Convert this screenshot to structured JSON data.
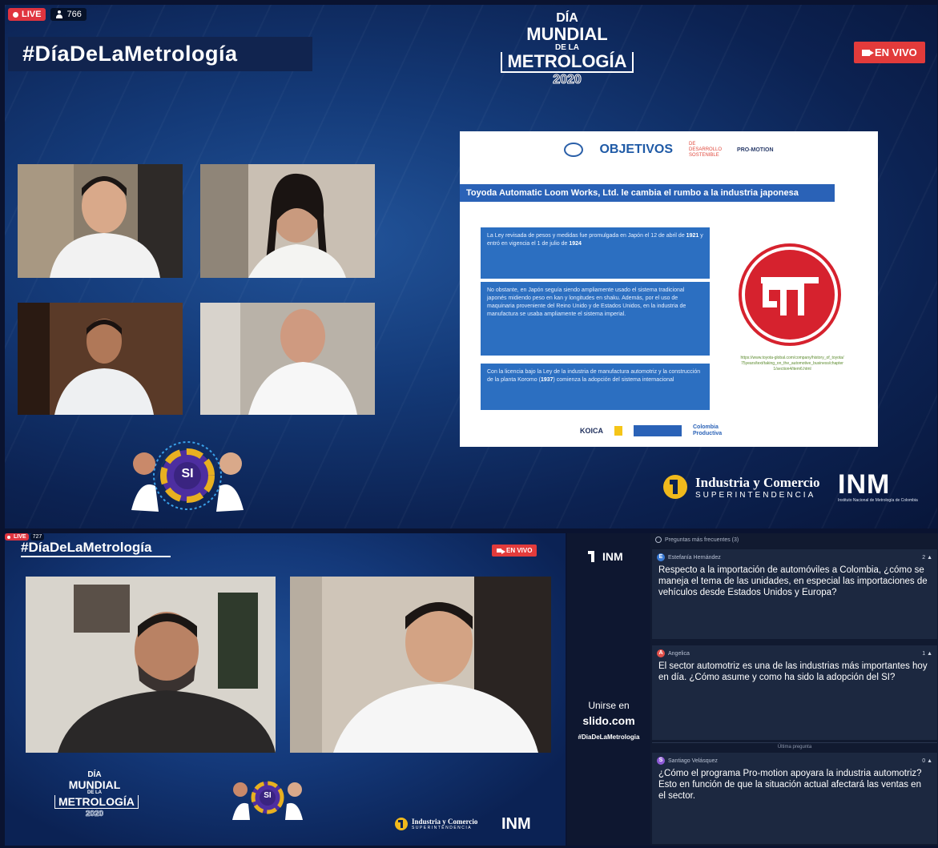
{
  "top": {
    "live_label": "LIVE",
    "viewer_count": "766",
    "hashtag": "#DíaDeLaMetrología",
    "en_vivo": "EN VIVO",
    "logo": {
      "line1": "DÍA",
      "line2": "MUNDIAL",
      "line3": "DE LA",
      "line4": "METROLOGÍA",
      "year": "2020"
    },
    "slide": {
      "header_logo_objetivos": "OBJETIVOS",
      "header_logo_ods": "DE DESARROLLO SOSTENIBLE",
      "header_logo_promotion": "PRO-MOTION",
      "title": "Toyoda Automatic Loom Works, Ltd. le cambia el rumbo a la industria japonesa",
      "box1_a": "La Ley revisada de pesos y medidas fue promulgada en Japón el 12 de abril de ",
      "box1_b": "1921",
      "box1_c": " y entró en vigencia el 1 de julio de ",
      "box1_d": "1924",
      "box2": "No obstante, en Japón seguía siendo ampliamente usado el sistema tradicional japonés midiendo peso en kan y longitudes en shaku. Además, por el uso de maquinaria proveniente del Reino Unido y de Estados Unidos, en la industria de manufactura se usaba ampliamente el sistema imperial.",
      "box3_a": "Con la licencia bajo la Ley de la industria de manufactura automotriz y la construcción de la planta Koromo (",
      "box3_b": "1937",
      "box3_c": ") comienza la adopción del sistema internacional",
      "link": "https://www.toyota-global.com/company/history_of_toyota/75years/text/taking_on_the_automotive_business/chapter1/section4/item6.html",
      "footer_koica": "KOICA",
      "footer_colombia": "Colombia Productiva"
    },
    "si_label": "SI",
    "sic_name": "Industria y Comercio",
    "sic_sub": "SUPERINTENDENCIA",
    "inm": "INM",
    "inm_sub": "Instituto Nacional de Metrología de Colombia"
  },
  "bottom": {
    "live_label": "LIVE",
    "viewer_count": "727",
    "hashtag": "#DíaDeLaMetrología",
    "en_vivo": "EN VIVO",
    "logo": {
      "line1": "DÍA",
      "line2": "MUNDIAL",
      "line3": "DE LA",
      "line4": "METROLOGÍA",
      "year": "2020"
    },
    "si_label": "SI",
    "sic_name": "Industria y Comercio",
    "sic_sub": "SUPERINTENDENCIA",
    "inm": "INM"
  },
  "slido": {
    "join_text": "Unirse en",
    "site": "slido.com",
    "hashtag": "#DiaDeLaMetrologia",
    "header": "Preguntas más frecuentes (3)",
    "divider": "Última pregunta",
    "questions": [
      {
        "initial": "E",
        "author": "Estefanía Hernández",
        "likes": "2",
        "text": "Respecto a la importación de automóviles a Colombia, ¿cómo se maneja el tema de las unidades, en especial las importaciones de vehículos desde Estados Unidos y Europa?",
        "color": "#3a7bd5"
      },
      {
        "initial": "A",
        "author": "Angelica",
        "likes": "1",
        "text": "El sector automotriz es una de las industrias más importantes hoy en día. ¿Cómo asume y como ha sido la adopción del SI?",
        "color": "#e2504a"
      },
      {
        "initial": "S",
        "author": "Santiago Velásquez",
        "likes": "0",
        "text": "¿Cómo el programa Pro-motion apoyara la industria automotriz? Esto en función de que la situación actual afectará las ventas en el sector.",
        "color": "#8e5bd6"
      }
    ]
  }
}
